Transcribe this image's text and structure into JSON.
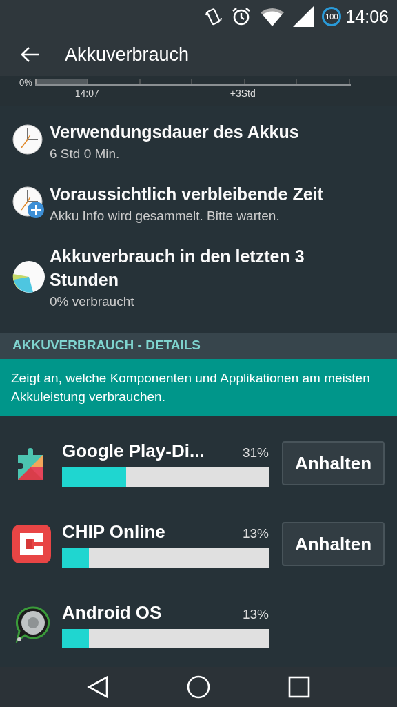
{
  "status_bar": {
    "battery": "100",
    "time": "14:06"
  },
  "app_bar": {
    "title": "Akkuverbrauch"
  },
  "history": {
    "y_label": "0%",
    "x_labels": [
      "14:07",
      "+3Std"
    ]
  },
  "summary": [
    {
      "kind": "clock",
      "title": "Verwendungsdauer des Akkus",
      "subtitle": "6 Std 0 Min."
    },
    {
      "kind": "clock-plus",
      "title": "Voraussichtlich verbleibende Zeit",
      "subtitle": "Akku Info wird gesammelt. Bitte warten."
    },
    {
      "kind": "pie",
      "title": "Akkuverbrauch in den letzten 3 Stunden",
      "subtitle": "0% verbraucht"
    }
  ],
  "section": {
    "header": "AKKUVERBRAUCH - DETAILS",
    "info": "Zeigt an, welche Komponenten und Applikationen am meisten Akkuleistung verbrauchen."
  },
  "apps": [
    {
      "name": "Google Play-Di...",
      "percent": "31%",
      "level": 0.31,
      "button": "Anhalten"
    },
    {
      "name": "CHIP Online",
      "percent": "13%",
      "level": 0.13,
      "button": "Anhalten"
    },
    {
      "name": "Android OS",
      "percent": "13%",
      "level": 0.13
    }
  ]
}
